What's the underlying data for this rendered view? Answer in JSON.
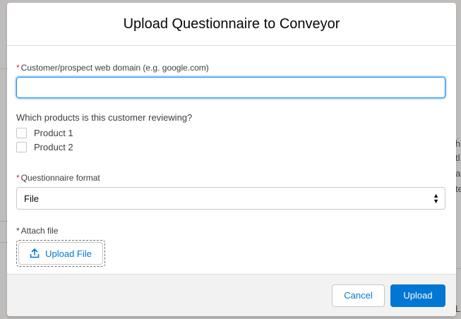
{
  "modal": {
    "title": "Upload Questionnaire to Conveyor"
  },
  "domain_field": {
    "required_marker": "*",
    "label": "Customer/prospect web domain (e.g. google.com)",
    "value": "",
    "placeholder": ""
  },
  "products": {
    "question": "Which products is this customer reviewing?",
    "options": [
      {
        "label": "Product 1",
        "checked": false
      },
      {
        "label": "Product 2",
        "checked": false
      }
    ]
  },
  "format_field": {
    "required_marker": "*",
    "label": "Questionnaire format",
    "selected": "File"
  },
  "attach_field": {
    "required_marker": "*",
    "label": "Attach file",
    "button_label": "Upload File"
  },
  "footer": {
    "cancel_label": "Cancel",
    "upload_label": "Upload"
  },
  "colors": {
    "brand": "#0176d3",
    "required": "#c23934",
    "focus_border": "#1b96ff"
  },
  "background_page": {
    "fragments": [
      "h",
      "tl",
      "a",
      "te",
      "L"
    ]
  }
}
